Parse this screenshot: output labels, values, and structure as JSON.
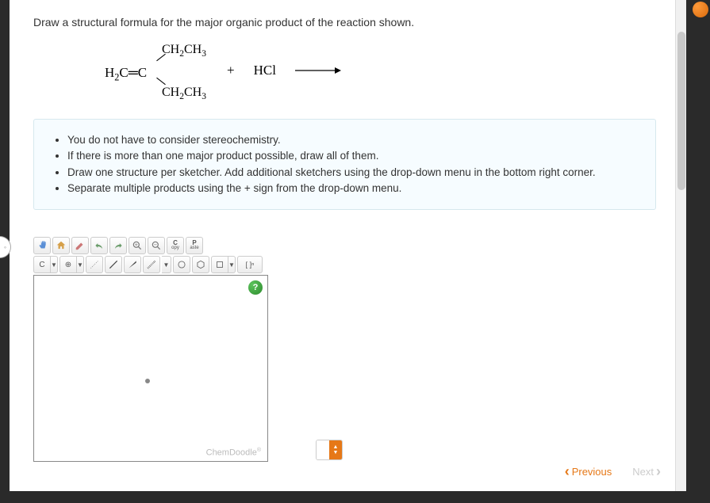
{
  "question": "Draw a structural formula for the major organic product of the reaction shown.",
  "reaction": {
    "molecule_top": "CH₂CH₃",
    "molecule_mid_left": "H₂C",
    "molecule_mid_right": "C",
    "molecule_bot": "CH₂CH₃",
    "plus": "+",
    "reagent": "HCl"
  },
  "hints": [
    "You do not have to consider stereochemistry.",
    "If there is more than one major product possible, draw all of them.",
    "Draw one structure per sketcher. Add additional sketchers using the drop-down menu in the bottom right corner.",
    "Separate multiple products using the + sign from the drop-down menu."
  ],
  "toolbar1": {
    "hand": "hand",
    "home": "home",
    "pencil": "pencil",
    "undo": "undo",
    "redo": "redo",
    "zoom_in": "zoom-in",
    "zoom_out": "zoom-out",
    "copy_label": "C",
    "copy_sub": "opy",
    "paste_label": "P",
    "paste_sub": "aste"
  },
  "toolbar2": {
    "carbon": "C",
    "charge": "⊕",
    "bond_dash": "bond",
    "bond_single": "/",
    "bond_wedge": "wedge",
    "bond_hash": "hash",
    "ring": "○",
    "benzene": "⬡",
    "box": "□",
    "bracket": "[ ]ⁿ"
  },
  "sketcher": {
    "brand": "ChemDoodle",
    "help": "?"
  },
  "nav": {
    "previous": "Previous",
    "next": "Next"
  }
}
